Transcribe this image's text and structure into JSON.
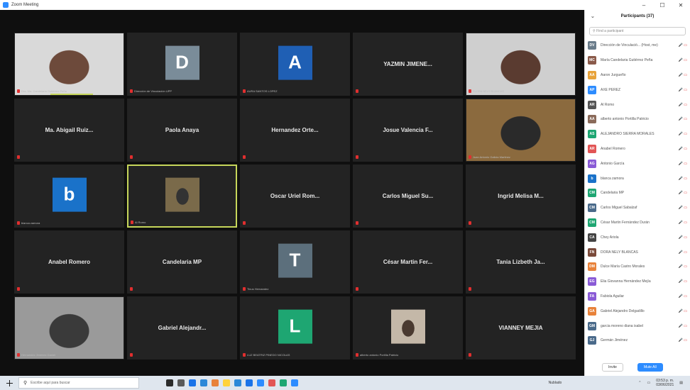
{
  "window": {
    "title": "Zoom Meeting",
    "minimize": "–",
    "maximize": "☐",
    "close": "✕"
  },
  "tiles": [
    {
      "type": "video",
      "name": "Dra. Ma. Candelaria Gutiérrez Peña",
      "colors": [
        "#d9d9d9",
        "#6d4a3b"
      ],
      "speaker": true
    },
    {
      "type": "avatar",
      "letter": "D",
      "color": "#7a8c99",
      "name": "Dirección de Vinculación UPP"
    },
    {
      "type": "avatar",
      "letter": "A",
      "color": "#1f5fb4",
      "name": "AURA SANTOS LOPEZ"
    },
    {
      "type": "name",
      "big": "YAZMIN JIMENE...",
      "name": ""
    },
    {
      "type": "video",
      "name": "FLORA NELY BLANCAS",
      "colors": [
        "#cfcfcf",
        "#5a3b30"
      ]
    },
    {
      "type": "name",
      "big": "Ma. Abigail Ruiz...",
      "name": ""
    },
    {
      "type": "name",
      "big": "Paola Anaya",
      "name": ""
    },
    {
      "type": "name",
      "big": "Hernandez Orte...",
      "name": ""
    },
    {
      "type": "name",
      "big": "Josue Valencia F...",
      "name": ""
    },
    {
      "type": "video",
      "name": "Juan Antonio Galicia Martinez",
      "colors": [
        "#8b6a3e",
        "#2a2a2a"
      ]
    },
    {
      "type": "avatar",
      "letter": "b",
      "color": "#1a72c9",
      "name": "blanca zamora"
    },
    {
      "type": "pic",
      "name": "Al Romo",
      "active": true,
      "colors": [
        "#7a6a4a",
        "#333"
      ]
    },
    {
      "type": "name",
      "big": "Oscar Uriel Rom...",
      "name": ""
    },
    {
      "type": "name",
      "big": "Carlos Miguel Su...",
      "name": ""
    },
    {
      "type": "name",
      "big": "Ingrid Melisa M...",
      "name": ""
    },
    {
      "type": "name",
      "big": "Anabel Romero",
      "name": ""
    },
    {
      "type": "name",
      "big": "Candelaria MP",
      "name": ""
    },
    {
      "type": "avatar",
      "letter": "T",
      "color": "#5c6f7c",
      "name": "Tinus Hernandez"
    },
    {
      "type": "name",
      "big": "César Martin Fer...",
      "name": ""
    },
    {
      "type": "name",
      "big": "Tania Lizbeth Ja...",
      "name": ""
    },
    {
      "type": "video",
      "name": "Hernandez Jimenez Daniel",
      "colors": [
        "#9a9a9a",
        "#3a3a3a"
      ]
    },
    {
      "type": "name",
      "big": "Gabriel Alejandr...",
      "name": ""
    },
    {
      "type": "avatar",
      "letter": "L",
      "color": "#1ea672",
      "name": "LUZ BEATRIZ PINEDO NICOLAS"
    },
    {
      "type": "pic",
      "name": "alberto antonio Portilla Patricio",
      "colors": [
        "#c4b8a8",
        "#4a3a30"
      ]
    },
    {
      "type": "name",
      "big": "VIANNEY MEJIA",
      "name": ""
    }
  ],
  "panel": {
    "back": "⌄",
    "title": "Participants (37)",
    "search_placeholder": "Find a participant",
    "participants": [
      {
        "initials": "DV",
        "color": "#6a7c8a",
        "name": "Dirección de Vinculació... (Host, me)",
        "icons": "🎤 ▭"
      },
      {
        "initials": "MC",
        "color": "#8a5a4a",
        "name": "María Candelaria Gutiérrez Peña",
        "icons": "🎤 ▭"
      },
      {
        "initials": "AA",
        "color": "#e8a33a",
        "name": "Aaron Jurgueño",
        "icons": "🎤 ▭"
      },
      {
        "initials": "AP",
        "color": "#2d8cff",
        "name": "AXE PEREZ",
        "icons": "🎤 ▭"
      },
      {
        "initials": "AR",
        "color": "#555",
        "name": "Al Romo",
        "icons": "🎤 ▭"
      },
      {
        "initials": "AA",
        "color": "#8a6a5a",
        "name": "alberto antonio Portilla Patricio",
        "icons": "🎤 ▭"
      },
      {
        "initials": "AS",
        "color": "#1ea672",
        "name": "ALEJANDRO SIERRA MORALES",
        "icons": "🎤 ▭"
      },
      {
        "initials": "AR",
        "color": "#e25555",
        "name": "Anabel Romero",
        "icons": "🎤 ▭"
      },
      {
        "initials": "AG",
        "color": "#8a5bd6",
        "name": "Antonio García",
        "icons": "🎤 ▭"
      },
      {
        "initials": "b",
        "color": "#1a72c9",
        "name": "blanca zamora",
        "icons": "🎤 ▭"
      },
      {
        "initials": "CM",
        "color": "#1ea672",
        "name": "Candelaria MP",
        "icons": "🎤 ▭"
      },
      {
        "initials": "CM",
        "color": "#4a6a8a",
        "name": "Carlos Miguel Sabalzaf",
        "icons": "🎤 ▭"
      },
      {
        "initials": "CM",
        "color": "#1ea672",
        "name": "César Martin Fernández Durán",
        "icons": "🎤 ▭"
      },
      {
        "initials": "CA",
        "color": "#444",
        "name": "Chey Ariola",
        "icons": "🎤 ▭"
      },
      {
        "initials": "FN",
        "color": "#7a4a3a",
        "name": "DORA NELY BLANCAS",
        "icons": "🎤 ▭"
      },
      {
        "initials": "DM",
        "color": "#e8823a",
        "name": "Dulce María Castro Morales",
        "icons": "🎤 ▭"
      },
      {
        "initials": "EG",
        "color": "#8a5bd6",
        "name": "Elia Giovanna Hernández Mejía",
        "icons": "🎤 ▭"
      },
      {
        "initials": "FA",
        "color": "#8a5bd6",
        "name": "Fabiola Aguilar",
        "icons": "🎤 ▭"
      },
      {
        "initials": "GA",
        "color": "#e8823a",
        "name": "Gabriel Alejandro Delgadillo",
        "icons": "🎤 ▭"
      },
      {
        "initials": "GM",
        "color": "#4a6a8a",
        "name": "garcia moreno diana isabel",
        "icons": "🎤 ▭"
      },
      {
        "initials": "GJ",
        "color": "#4a6a8a",
        "name": "Germán Jiménez",
        "icons": "🎤 ▭"
      }
    ],
    "invite": "Invite",
    "mute_all": "Mute All"
  },
  "taskbar": {
    "search": "Escribe aquí para buscar",
    "weather": "Nublado",
    "time": "03:53 p. m.",
    "date": "03/06/2021",
    "icon_colors": [
      "#2b2b2b",
      "#5a5a5a",
      "#1a73e8",
      "#2b88d8",
      "#e8823a",
      "#ffd23a",
      "#2b88d8",
      "#1a73e8",
      "#2d8cff",
      "#e25555",
      "#1ea672",
      "#2d8cff"
    ]
  }
}
